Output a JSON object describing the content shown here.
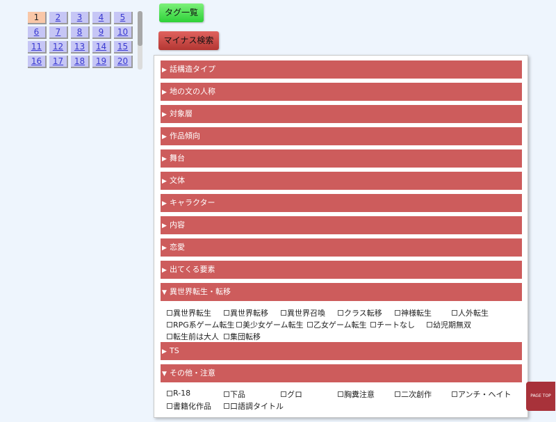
{
  "pagination": {
    "current": "1",
    "pages": [
      "1",
      "2",
      "3",
      "4",
      "5",
      "6",
      "7",
      "8",
      "9",
      "10",
      "11",
      "12",
      "13",
      "14",
      "15",
      "16",
      "17",
      "18",
      "19",
      "20"
    ]
  },
  "buttons": {
    "tag_list": "タグ一覧",
    "minus_search": "マイナス検索",
    "page_top": "PAGE TOP"
  },
  "arrows": {
    "collapsed": "▶",
    "expanded": "▼"
  },
  "categories": [
    {
      "label": "話構造タイプ",
      "expanded": false
    },
    {
      "label": "地の文の人称",
      "expanded": false
    },
    {
      "label": "対象層",
      "expanded": false
    },
    {
      "label": "作品傾向",
      "expanded": false
    },
    {
      "label": "舞台",
      "expanded": false
    },
    {
      "label": "文体",
      "expanded": false
    },
    {
      "label": "キャラクター",
      "expanded": false
    },
    {
      "label": "内容",
      "expanded": false
    },
    {
      "label": "恋愛",
      "expanded": false
    },
    {
      "label": "出てくる要素",
      "expanded": false
    },
    {
      "label": "異世界転生・転移",
      "expanded": true,
      "options": [
        "異世界転生",
        "異世界転移",
        "異世界召喚",
        "クラス転移",
        "神様転生",
        "人外転生",
        "RPG系ゲーム転生",
        "美少女ゲーム転生",
        "乙女ゲーム転生",
        "チートなし",
        "幼児期無双",
        "転生前は大人",
        "集団転移"
      ]
    },
    {
      "label": "TS",
      "expanded": false
    },
    {
      "label": "その他・注意",
      "expanded": true,
      "options": [
        "R-18",
        "下品",
        "グロ",
        "胸糞注意",
        "二次創作",
        "アンチ・ヘイト",
        "書籍化作品",
        "口語調タイトル"
      ]
    }
  ],
  "colors": {
    "category_bar": "#cd5c5c",
    "tag_button": "#2ed138",
    "minus_button": "#b43733",
    "page_link": "#c6c6f5",
    "page_current": "#f9c7a8",
    "page_top": "#a8323a"
  }
}
